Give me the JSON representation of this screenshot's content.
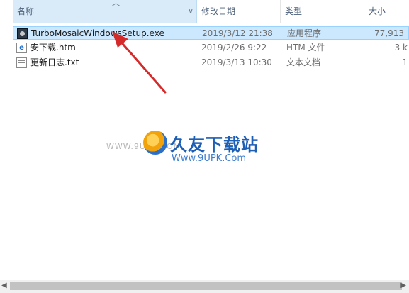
{
  "columns": {
    "name": "名称",
    "date": "修改日期",
    "type": "类型",
    "size": "大小"
  },
  "files": [
    {
      "name": "TurboMosaicWindowsSetup.exe",
      "date": "2019/3/12 21:38",
      "type": "应用程序",
      "size": "77,913",
      "icon": "exe-icon",
      "selected": true
    },
    {
      "name": "安下载.htm",
      "date": "2019/2/26 9:22",
      "type": "HTM 文件",
      "size": "3 k",
      "icon": "htm-icon",
      "selected": false
    },
    {
      "name": "更新日志.txt",
      "date": "2019/3/13 10:30",
      "type": "文本文档",
      "size": "1",
      "icon": "txt-icon",
      "selected": false
    }
  ],
  "watermark": {
    "left_text": "WWW.9UPK.COM",
    "title": "久友下载站",
    "url": "Www.9UPK.Com"
  },
  "colors": {
    "selection": "#cce8ff",
    "arrow": "#d42a2a"
  }
}
